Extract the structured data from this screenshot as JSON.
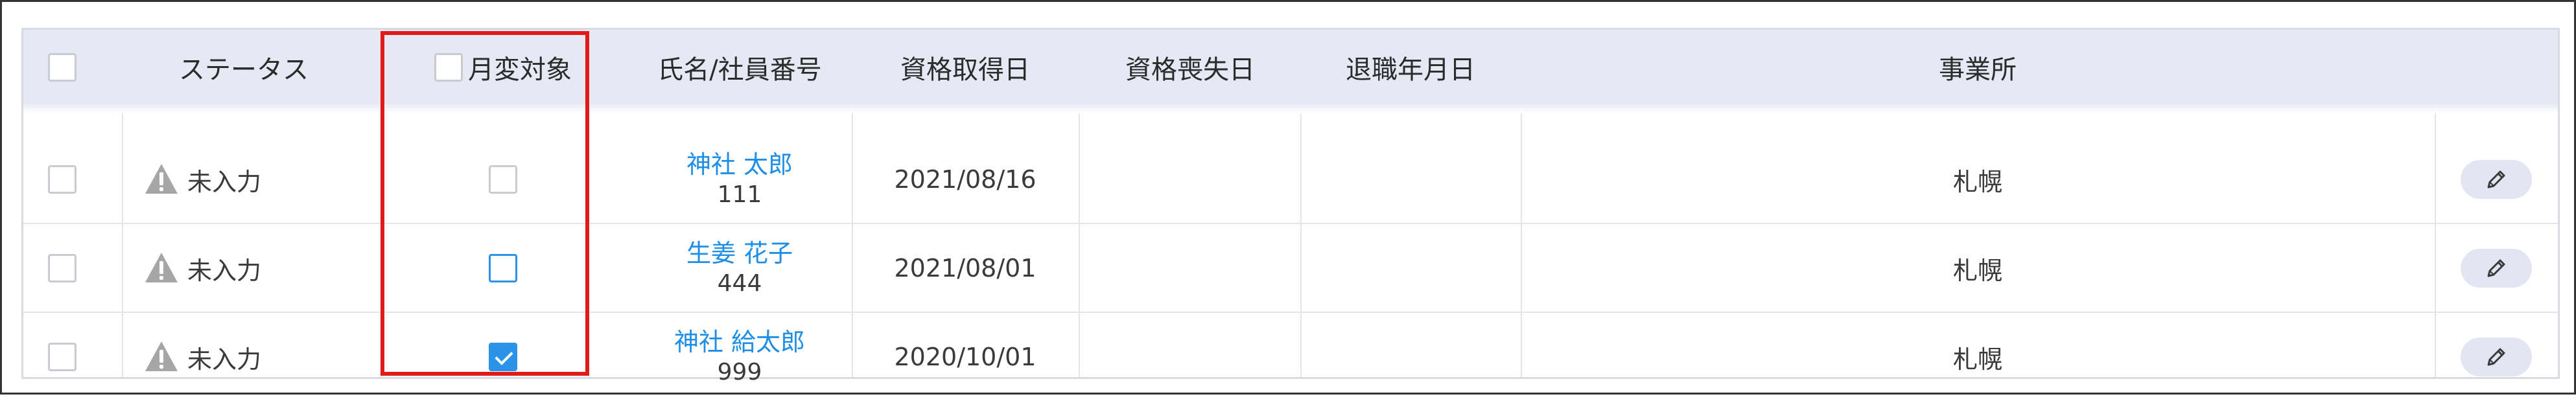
{
  "header": {
    "select_all": false,
    "status": "ステータス",
    "monthly_change_target": "月変対象",
    "name_employee_no": "氏名/社員番号",
    "qualification_acquired_date": "資格取得日",
    "qualification_lost_date": "資格喪失日",
    "retirement_date": "退職年月日",
    "office": "事業所"
  },
  "rows": [
    {
      "status": "未入力",
      "monthly_change_target": "disabled",
      "name": "神社 太郎",
      "employee_no": "111",
      "acquired_date": "2021/08/16",
      "lost_date": "",
      "retirement_date": "",
      "office": "札幌"
    },
    {
      "status": "未入力",
      "monthly_change_target": "unchecked",
      "name": "生姜 花子",
      "employee_no": "444",
      "acquired_date": "2021/08/01",
      "lost_date": "",
      "retirement_date": "",
      "office": "札幌"
    },
    {
      "status": "未入力",
      "monthly_change_target": "checked",
      "name": "神社 給太郎",
      "employee_no": "999",
      "acquired_date": "2020/10/01",
      "lost_date": "",
      "retirement_date": "",
      "office": "札幌"
    }
  ],
  "icons": {
    "status": "warning-triangle-icon",
    "edit": "pencil-icon"
  },
  "colors": {
    "header_bg": "#e6e8f4",
    "link": "#1f8ee6",
    "checkbox_active": "#2a93e8",
    "highlight": "#e21a1a"
  }
}
